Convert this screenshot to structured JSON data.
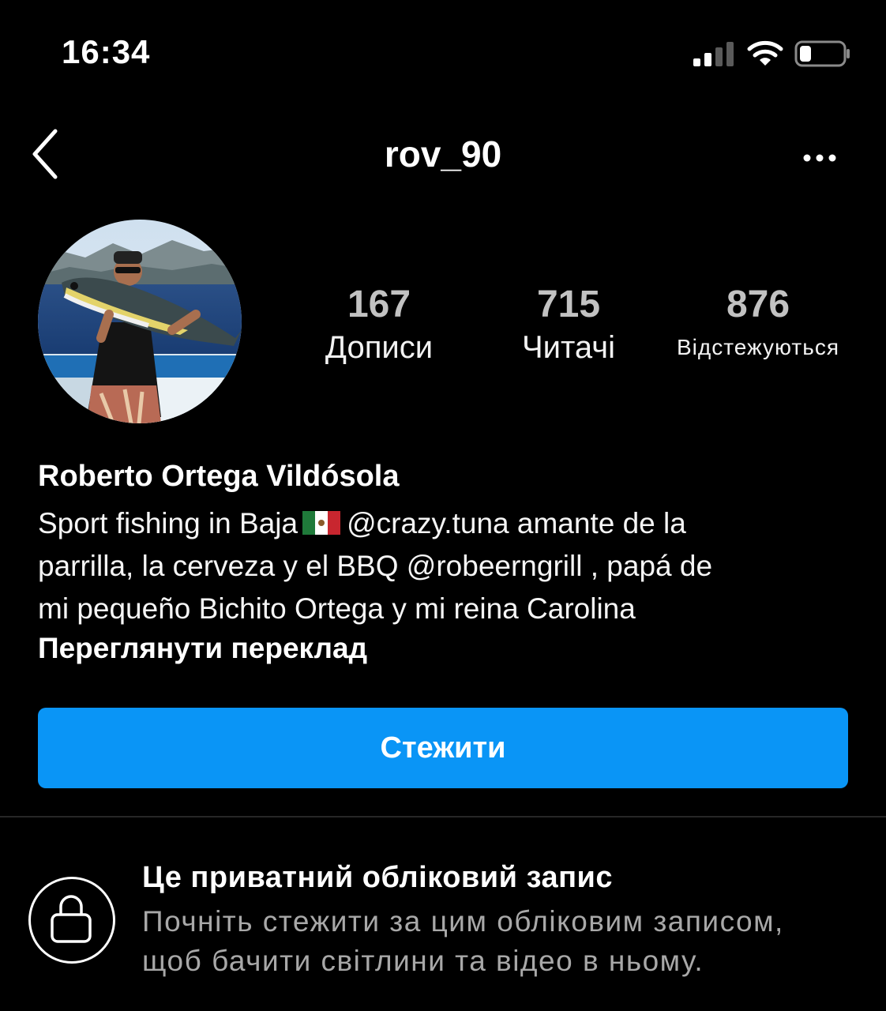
{
  "status_bar": {
    "time": "16:34",
    "icons": [
      "cellular-signal-icon",
      "wifi-icon",
      "battery-icon"
    ]
  },
  "header": {
    "back_icon": "chevron-left-icon",
    "username": "rov_90",
    "more_icon": "ellipsis-icon"
  },
  "profile": {
    "avatar": "profile-photo-man-holding-tuna",
    "stats": {
      "posts": {
        "count": "167",
        "label": "Дописи"
      },
      "followers": {
        "count": "715",
        "label": "Читачі"
      },
      "following": {
        "count": "876",
        "label": "Відстежуються"
      }
    },
    "full_name": "Roberto Ortega Vildósola",
    "bio": {
      "line1_prefix": "Sport fishing in Baja",
      "flag_icon": "mexico-flag-icon",
      "line1_mention": "@crazy.tuna",
      "line1_suffix": " amante de la",
      "line2_prefix": "parrilla, la cerveza y el BBQ ",
      "line2_mention": "@robeerngrill",
      "line2_suffix": " , papá de",
      "line3": "mi pequeño Bichito Ortega y mi reina Carolina"
    },
    "translate_label": "Переглянути переклад"
  },
  "follow_button": {
    "label": "Стежити"
  },
  "private_notice": {
    "icon": "lock-icon",
    "title": "Це приватний обліковий запис",
    "line1": "Почніть стежити за цим обліковим записом,",
    "line2": "щоб бачити світлини та відео в ньому."
  },
  "colors": {
    "background": "#000000",
    "accent": "#0a95f6",
    "stat_count": "#c2c2c2",
    "secondary_text": "#a8a8a8"
  }
}
